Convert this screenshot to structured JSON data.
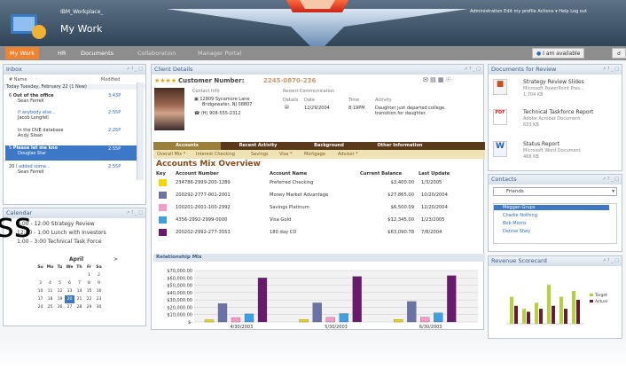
{
  "app": {
    "org": "IBM_Workplace_",
    "title": "My Work"
  },
  "toplinks": "Administration   Edit my profile   Actions ▾   Help   Log out",
  "tabs": [
    "My Work",
    "HR",
    "Documents",
    "Collaboration",
    "Manager Portal"
  ],
  "status": {
    "availability": "I am available"
  },
  "inbox": {
    "title": "Inbox",
    "col_name": "# Name",
    "col_modified": "Modified",
    "today": "Today  Tuesday, February 22 (1 New)",
    "items": [
      {
        "n": "6",
        "subject": "Out of the office",
        "from": "Sean Ferrell",
        "time": "3:43P"
      },
      {
        "subject": "If anybody else...",
        "from": "Jacob Longfell",
        "time": "2:55P"
      },
      {
        "subject": "In the DUE database",
        "from": "Andy Sloan",
        "time": "2:25P"
      },
      {
        "n": "5",
        "subject": "Please let me kno",
        "from": "Douglas Star",
        "time": "2:55P"
      },
      {
        "n": "20",
        "subject": "I added some...",
        "from": "Sean Ferrell",
        "time": "2:55P"
      }
    ]
  },
  "calendar": {
    "title": "Calendar",
    "events": [
      "9:00 - 12:00  Strategy Review",
      "12:00 - 1:00  Lunch with Investors",
      "1:00 - 3:00  Technical Task Force"
    ],
    "month": "April",
    "days": [
      "Su",
      "Mo",
      "Tu",
      "We",
      "Th",
      "Fr",
      "Sa"
    ],
    "weeks": [
      [
        "",
        "",
        "",
        "",
        "",
        "1",
        "2"
      ],
      [
        "3",
        "4",
        "5",
        "6",
        "7",
        "8",
        "9"
      ],
      [
        "10",
        "11",
        "12",
        "13",
        "14",
        "15",
        "16"
      ],
      [
        "17",
        "18",
        "19",
        "20",
        "21",
        "22",
        "23"
      ],
      [
        "24",
        "25",
        "26",
        "27",
        "28",
        "29",
        "30"
      ]
    ],
    "today": "20"
  },
  "client": {
    "title": "Client Details",
    "stars": "★★★★",
    "customer_label": "Customer Number:",
    "customer_number": "2245-0870-236",
    "contact_label": "Contact Info",
    "address1": "12809 Sycamore Lane",
    "address2": "Bridgewater, NJ 08807",
    "phone": "(H) 908-555-2312",
    "recent_label": "Recent Communication",
    "comm_headers": [
      "Details",
      "Date",
      "Time",
      "Activity"
    ],
    "comm": {
      "date": "12/29/2004",
      "time": "8:19PM",
      "activity": "Daughter just departed college.",
      "activity2": "transition for daughter."
    },
    "tabs": [
      "Accounts",
      "Recent Activity",
      "Background",
      "Other Information"
    ],
    "subtabs": [
      "Overall Mix *",
      "Interest Checking",
      "Savings",
      "Visa *",
      "Mortgage",
      "Advisor *"
    ],
    "mix_title": "Accounts Mix Overview",
    "table_headers": [
      "Key",
      "Account Number",
      "Account Name",
      "Current Balance",
      "Last Update"
    ],
    "accounts": [
      {
        "number": "234786-2999-200-1289",
        "name": "Preferred Checking",
        "balance": "$3,400.00",
        "updated": "1/3/2005",
        "color": "#f5d800"
      },
      {
        "number": "200292-2777-001-2001",
        "name": "Money Market Advantage",
        "balance": "$27,865.00",
        "updated": "10/20/2004",
        "color": "#6b72a8"
      },
      {
        "number": "100201-2001-100-2992",
        "name": "Savings Platinum",
        "balance": "$6,500.09",
        "updated": "12/20/2004",
        "color": "#f59ac8"
      },
      {
        "number": "4356-2992-2999-0000",
        "name": "Visa Gold",
        "balance": "$12,345.00",
        "updated": "1/23/2005",
        "color": "#3aa0e8"
      },
      {
        "number": "200202-2992-277-3553",
        "name": "180 day CD",
        "balance": "$63,090.78",
        "updated": "7/8/2004",
        "color": "#6a1a6e"
      }
    ],
    "relationship_title": "Relationship Mix"
  },
  "chart_data": {
    "type": "bar",
    "title": "Relationship Mix",
    "categories": [
      "4/30/2003",
      "5/30/2003",
      "6/30/2003"
    ],
    "yticks": [
      "$70,000.00",
      "$60,000.00",
      "$50,000.00",
      "$40,000.00",
      "$30,000.00",
      "$20,000.00",
      "$10,000.00",
      "$-"
    ],
    "ylim": [
      0,
      70000
    ],
    "series": [
      {
        "color": "#f5d800",
        "values": [
          3000,
          3200,
          3400
        ]
      },
      {
        "color": "#6b72a8",
        "values": [
          25000,
          26000,
          27865
        ]
      },
      {
        "color": "#f59ac8",
        "values": [
          6000,
          6200,
          6500
        ]
      },
      {
        "color": "#3aa0e8",
        "values": [
          11000,
          11500,
          12345
        ]
      },
      {
        "color": "#6a1a6e",
        "values": [
          60000,
          62000,
          63090
        ]
      }
    ]
  },
  "docs": {
    "title": "Documents for Review",
    "items": [
      {
        "name": "Strategy Review Slides",
        "type": "Microsoft PowerPoint Pres...",
        "size": "1,704 KB",
        "icon": "ppt"
      },
      {
        "name": "Technical Taskforce Report",
        "type": "Adobe Acrobat Document",
        "size": "633 KB",
        "icon": "pdf"
      },
      {
        "name": "Status Report",
        "type": "Microsoft Word Document",
        "size": "468 KB",
        "icon": "doc"
      }
    ]
  },
  "contacts": {
    "title": "Contacts",
    "filter": "Friends",
    "items": [
      "Meggan Grups",
      "Charlie Nothing",
      "Bob Morris",
      "Denise Shey"
    ]
  },
  "revenue": {
    "title": "Revenue Scorecard",
    "legend": [
      "Target",
      "Actual"
    ],
    "target": [
      4.5,
      2.5,
      3.5,
      6.5,
      4.5,
      5.5
    ],
    "actual": [
      3,
      2,
      2.5,
      3,
      2.5,
      4
    ]
  },
  "overlay_text": "ss"
}
